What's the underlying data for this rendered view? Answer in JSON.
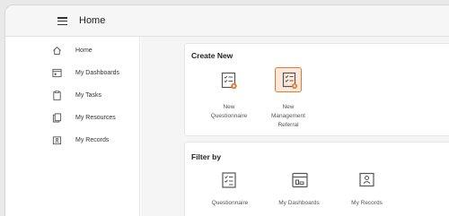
{
  "header": {
    "title": "Home",
    "menu_icon": "hamburger-menu-icon"
  },
  "sidebar": {
    "items": [
      {
        "label": "Home",
        "icon": "home-icon"
      },
      {
        "label": "My Dashboards",
        "icon": "dashboard-icon"
      },
      {
        "label": "My Tasks",
        "icon": "clipboard-icon"
      },
      {
        "label": "My Resources",
        "icon": "resources-icon"
      },
      {
        "label": "My Records",
        "icon": "records-icon"
      }
    ]
  },
  "create_new": {
    "title": "Create New",
    "tiles": [
      {
        "label_line1": "New",
        "label_line2": "Questionnaire",
        "label_line3": "",
        "icon": "questionnaire-add-icon"
      },
      {
        "label_line1": "New",
        "label_line2": "Management",
        "label_line3": "Referral",
        "icon": "referral-add-icon",
        "selected": true
      }
    ]
  },
  "filter_by": {
    "title": "Filter by",
    "tiles": [
      {
        "label": "Questionnaire",
        "icon": "questionnaire-icon"
      },
      {
        "label": "My Dashboards",
        "icon": "dashboard-icon"
      },
      {
        "label": "My Records",
        "icon": "records-person-icon"
      }
    ]
  },
  "colors": {
    "accent": "#e8772e",
    "selected_bg": "#fde8dc",
    "icon": "#555555"
  }
}
